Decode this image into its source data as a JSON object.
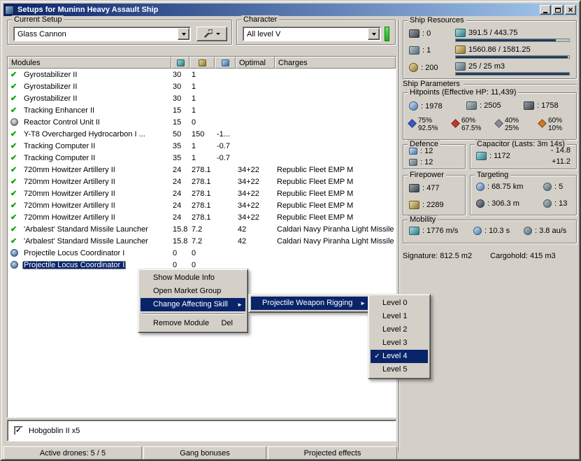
{
  "window": {
    "title": "Setups for Muninn Heavy Assault Ship"
  },
  "icons": {
    "close": "×",
    "check": "✔",
    "menu_check": "✓",
    "submenu_arrow": "►"
  },
  "colors": {
    "accent": "#0a246a",
    "titlebar_from": "#0a246a",
    "titlebar_to": "#a6caf0",
    "check_green": "#00a000",
    "skill_green": "#35d435"
  },
  "current_setup": {
    "label": "Current Setup",
    "value": "Glass Cannon"
  },
  "character": {
    "label": "Character",
    "value": "All level V"
  },
  "modules": {
    "header": {
      "name": "Modules",
      "optimal": "Optimal",
      "charges": "Charges"
    },
    "rows": [
      {
        "icon": "check",
        "name": "Gyrostabilizer II",
        "cpu": "30",
        "pg": "1",
        "cap": "",
        "optimal": "",
        "charges": ""
      },
      {
        "icon": "check",
        "name": "Gyrostabilizer II",
        "cpu": "30",
        "pg": "1",
        "cap": "",
        "optimal": "",
        "charges": ""
      },
      {
        "icon": "check",
        "name": "Gyrostabilizer II",
        "cpu": "30",
        "pg": "1",
        "cap": "",
        "optimal": "",
        "charges": ""
      },
      {
        "icon": "check",
        "name": "Tracking Enhancer II",
        "cpu": "15",
        "pg": "1",
        "cap": "",
        "optimal": "",
        "charges": ""
      },
      {
        "icon": "gear",
        "name": "Reactor Control Unit II",
        "cpu": "15",
        "pg": "0",
        "cap": "",
        "optimal": "",
        "charges": ""
      },
      {
        "icon": "check",
        "name": "Y-T8 Overcharged Hydrocarbon I ...",
        "cpu": "50",
        "pg": "150",
        "cap": "-1...",
        "optimal": "",
        "charges": ""
      },
      {
        "icon": "check",
        "name": "Tracking Computer II",
        "cpu": "35",
        "pg": "1",
        "cap": "-0.7",
        "optimal": "",
        "charges": ""
      },
      {
        "icon": "check",
        "name": "Tracking Computer II",
        "cpu": "35",
        "pg": "1",
        "cap": "-0.7",
        "optimal": "",
        "charges": ""
      },
      {
        "icon": "check",
        "name": "720mm Howitzer Artillery II",
        "cpu": "24",
        "pg": "278.1",
        "cap": "",
        "optimal": "34+22",
        "charges": "Republic Fleet EMP M"
      },
      {
        "icon": "check",
        "name": "720mm Howitzer Artillery II",
        "cpu": "24",
        "pg": "278.1",
        "cap": "",
        "optimal": "34+22",
        "charges": "Republic Fleet EMP M"
      },
      {
        "icon": "check",
        "name": "720mm Howitzer Artillery II",
        "cpu": "24",
        "pg": "278.1",
        "cap": "",
        "optimal": "34+22",
        "charges": "Republic Fleet EMP M"
      },
      {
        "icon": "check",
        "name": "720mm Howitzer Artillery II",
        "cpu": "24",
        "pg": "278.1",
        "cap": "",
        "optimal": "34+22",
        "charges": "Republic Fleet EMP M"
      },
      {
        "icon": "check",
        "name": "720mm Howitzer Artillery II",
        "cpu": "24",
        "pg": "278.1",
        "cap": "",
        "optimal": "34+22",
        "charges": "Republic Fleet EMP M"
      },
      {
        "icon": "check",
        "name": "'Arbalest' Standard Missile Launcher",
        "cpu": "15.8",
        "pg": "7.2",
        "cap": "",
        "optimal": "42",
        "charges": "Caldari Navy Piranha Light Missile"
      },
      {
        "icon": "check",
        "name": "'Arbalest' Standard Missile Launcher",
        "cpu": "15.8",
        "pg": "7.2",
        "cap": "",
        "optimal": "42",
        "charges": "Caldari Navy Piranha Light Missile"
      },
      {
        "icon": "rig",
        "name": "Projectile Locus Coordinator I",
        "cpu": "0",
        "pg": "0",
        "cap": "",
        "optimal": "",
        "charges": ""
      },
      {
        "icon": "rig",
        "name": "Projectile Locus Coordinator I",
        "cpu": "0",
        "pg": "0",
        "cap": "",
        "optimal": "",
        "charges": "",
        "selected": true
      }
    ]
  },
  "context_menu": {
    "items": [
      {
        "label": "Show Module Info"
      },
      {
        "label": "Open Market Group"
      },
      {
        "label": "Change Affecting Skill",
        "submenu": true,
        "highlighted": true
      },
      {
        "separator": true
      },
      {
        "label": "Remove Module",
        "shortcut": "Del"
      }
    ]
  },
  "skill_menu": {
    "label": "Projectile Weapon Rigging"
  },
  "level_menu": {
    "items": [
      "Level 0",
      "Level 1",
      "Level 2",
      "Level 3",
      "Level 4",
      "Level 5"
    ],
    "checked": "Level 4",
    "highlighted": "Level 4"
  },
  "ship_resources": {
    "label": "Ship Resources",
    "turrets": ": 0",
    "launchers": ": 1",
    "calibration": ": 200",
    "cpu": {
      "text": "391.5 / 443.75",
      "pct": 88
    },
    "powergrid": {
      "text": "1560.86 / 1581.25",
      "pct": 99
    },
    "dronebay": {
      "text": "25 / 25 m3",
      "pct": 100
    }
  },
  "ship_parameters": {
    "label": "Ship Parameters",
    "hitpoints": {
      "label": "Hitpoints (Effective HP: 11,439)",
      "shield": ": 1978",
      "armor": ": 2505",
      "structure": ": 1758",
      "resists": [
        {
          "type": "em",
          "color": "#3a58c8",
          "shield": "75%",
          "armor": "92.5%"
        },
        {
          "type": "thermal",
          "color": "#c03828",
          "shield": "60%",
          "armor": "67.5%"
        },
        {
          "type": "kinetic",
          "color": "#8a8a92",
          "shield": "40%",
          "armor": "25%"
        },
        {
          "type": "explosive",
          "color": "#d07820",
          "shield": "60%",
          "armor": "10%"
        }
      ]
    },
    "defence": {
      "label": "Defence",
      "shield_rate": ": 12",
      "armor_rate": ": 12"
    },
    "capacitor": {
      "label": "Capacitor (Lasts: 3m 14s)",
      "amount": ": 1172",
      "usage": "- 14.8",
      "recharge": "+11.2"
    },
    "firepower": {
      "label": "Firepower",
      "dps": ": 477",
      "volley": ": 2289"
    },
    "targeting": {
      "label": "Targeting",
      "range": ": 68.75 km",
      "max_targets": ": 5",
      "scan_resolution": ": 306.3 m",
      "sensor_strength": ": 13"
    },
    "mobility": {
      "label": "Mobility",
      "speed": ": 1776 m/s",
      "align_time": ": 10.3 s",
      "warp_speed": ": 3.8 au/s"
    },
    "signature": "Signature: 812.5 m2",
    "cargohold": "Cargohold: 415 m3"
  },
  "drones_panel": {
    "item": "Hobgoblin II x5",
    "checked": true
  },
  "status_bar": {
    "tabs": [
      "Active drones: 5 / 5",
      "Gang bonuses",
      "Projected effects"
    ]
  }
}
